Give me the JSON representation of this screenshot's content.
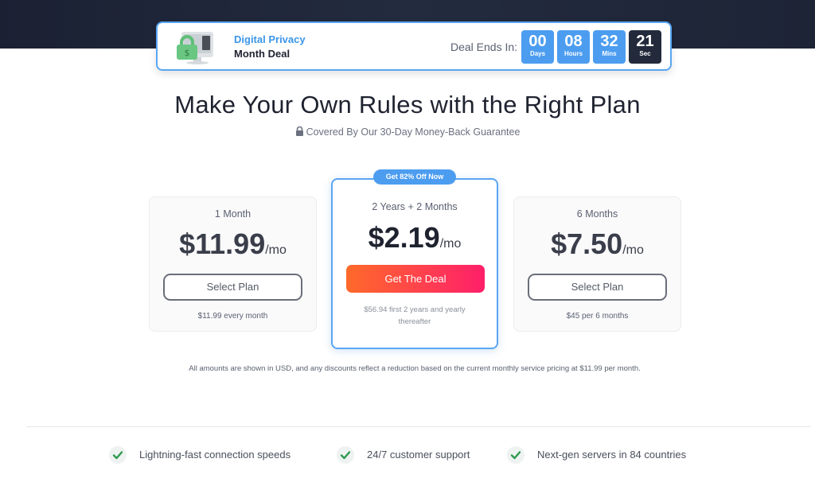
{
  "banner": {
    "title_line1": "Digital Privacy",
    "title_line2": "Month Deal",
    "deal_ends_label": "Deal Ends In:",
    "timer": [
      {
        "value": "00",
        "unit": "Days"
      },
      {
        "value": "08",
        "unit": "Hours"
      },
      {
        "value": "32",
        "unit": "Mins"
      },
      {
        "value": "21",
        "unit": "Sec"
      }
    ]
  },
  "headline": "Make Your Own Rules with the Right Plan",
  "guarantee": "Covered By Our 30-Day Money-Back Guarantee",
  "plans": {
    "left": {
      "name": "1 Month",
      "price": "$11.99",
      "per": "/mo",
      "button": "Select Plan",
      "note": "$11.99 every month"
    },
    "mid": {
      "badge": "Get 82% Off Now",
      "name": "2 Years + 2 Months",
      "price": "$2.19",
      "per": "/mo",
      "button": "Get The Deal",
      "note": "$56.94 first 2 years and yearly thereafter"
    },
    "right": {
      "name": "6 Months",
      "price": "$7.50",
      "per": "/mo",
      "button": "Select Plan",
      "note": "$45 per 6 months"
    }
  },
  "disclaimer": "All amounts are shown in USD, and any discounts reflect a reduction based on the current monthly service pricing at $11.99 per month.",
  "features": [
    "Lightning-fast connection speeds",
    "24/7 customer support",
    "Next-gen servers in 84 countries"
  ],
  "colors": {
    "accent_blue": "#4c9df0",
    "cta_start": "#ff6a2a",
    "cta_end": "#ff1f6a",
    "check_green": "#2e9b4f",
    "dark_bg": "#1b2133"
  },
  "icons": [
    "shield-monitor-illustration",
    "lock-icon",
    "check-icon"
  ]
}
